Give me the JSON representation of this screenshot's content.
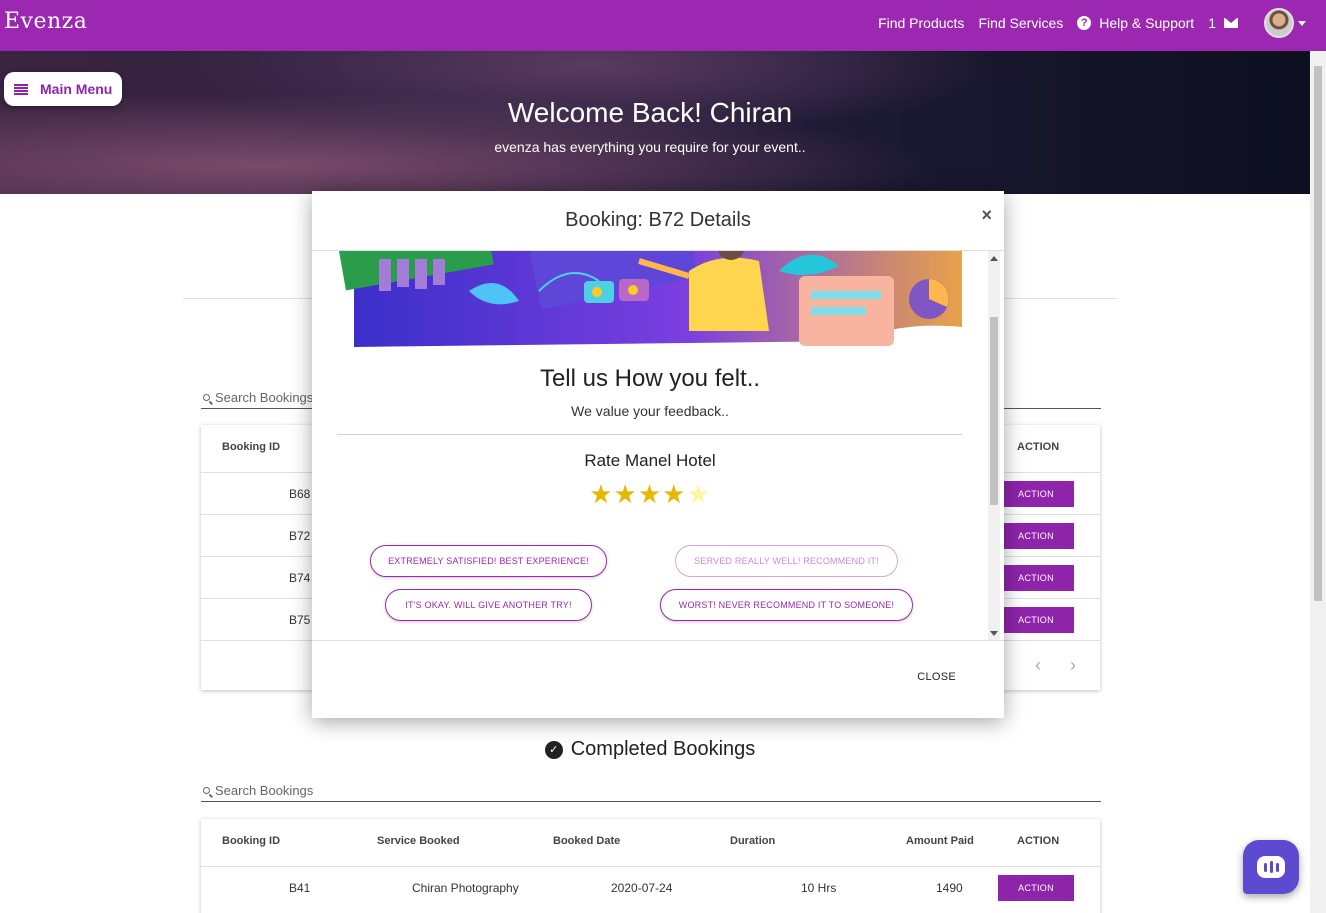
{
  "nav": {
    "brand": "Evenza",
    "find_products": "Find Products",
    "find_services": "Find Services",
    "help": "Help & Support",
    "message_count": "1"
  },
  "hero": {
    "title": "Welcome Back! Chiran",
    "subtitle": "evenza has everything you require for your event.."
  },
  "main_menu": {
    "label": "Main Menu"
  },
  "active_bookings": {
    "search_placeholder": "Search Bookings",
    "headers": {
      "booking_id": "Booking ID",
      "action": "ACTION"
    },
    "rows": [
      {
        "id": "B68",
        "action": "ACTION"
      },
      {
        "id": "B72",
        "action": "ACTION"
      },
      {
        "id": "B74",
        "action": "ACTION"
      },
      {
        "id": "B75",
        "action": "ACTION"
      }
    ]
  },
  "completed_bookings": {
    "title": "Completed Bookings",
    "search_placeholder": "Search Bookings",
    "headers": {
      "booking_id": "Booking ID",
      "service": "Service Booked",
      "date": "Booked Date",
      "duration": "Duration",
      "amount": "Amount Paid",
      "action": "ACTION"
    },
    "rows": [
      {
        "id": "B41",
        "service": "Chiran Photography",
        "date": "2020-07-24",
        "duration": "10 Hrs",
        "amount": "1490",
        "action": "ACTION"
      }
    ]
  },
  "modal": {
    "title": "Booking: B72 Details",
    "close_x": "×",
    "feedback_title": "Tell us How you felt..",
    "feedback_subtitle": "We value your feedback..",
    "rate_title": "Rate Manel Hotel",
    "rating": 4,
    "rating_max": 5,
    "chips": [
      "EXTREMELY SATISFIED! BEST EXPERIENCE!",
      "SERVED REALLY WELL! RECOMMEND IT!",
      "IT'S OKAY. WILL GIVE ANOTHER TRY!",
      "WORST! NEVER RECOMMEND IT TO SOMEONE!"
    ],
    "close_button": "CLOSE"
  },
  "colors": {
    "brand": "#9c27b0",
    "action": "#8e24aa",
    "star_on": "#e6b800",
    "star_off": "#fff59d",
    "chat": "#5c4bd1"
  },
  "icons": [
    "menu-icon",
    "help-icon",
    "mail-icon",
    "avatar",
    "search-icon",
    "check-circle-icon",
    "chevron-left-icon",
    "chevron-right-icon",
    "close-icon",
    "star-icon",
    "chat-icon"
  ]
}
